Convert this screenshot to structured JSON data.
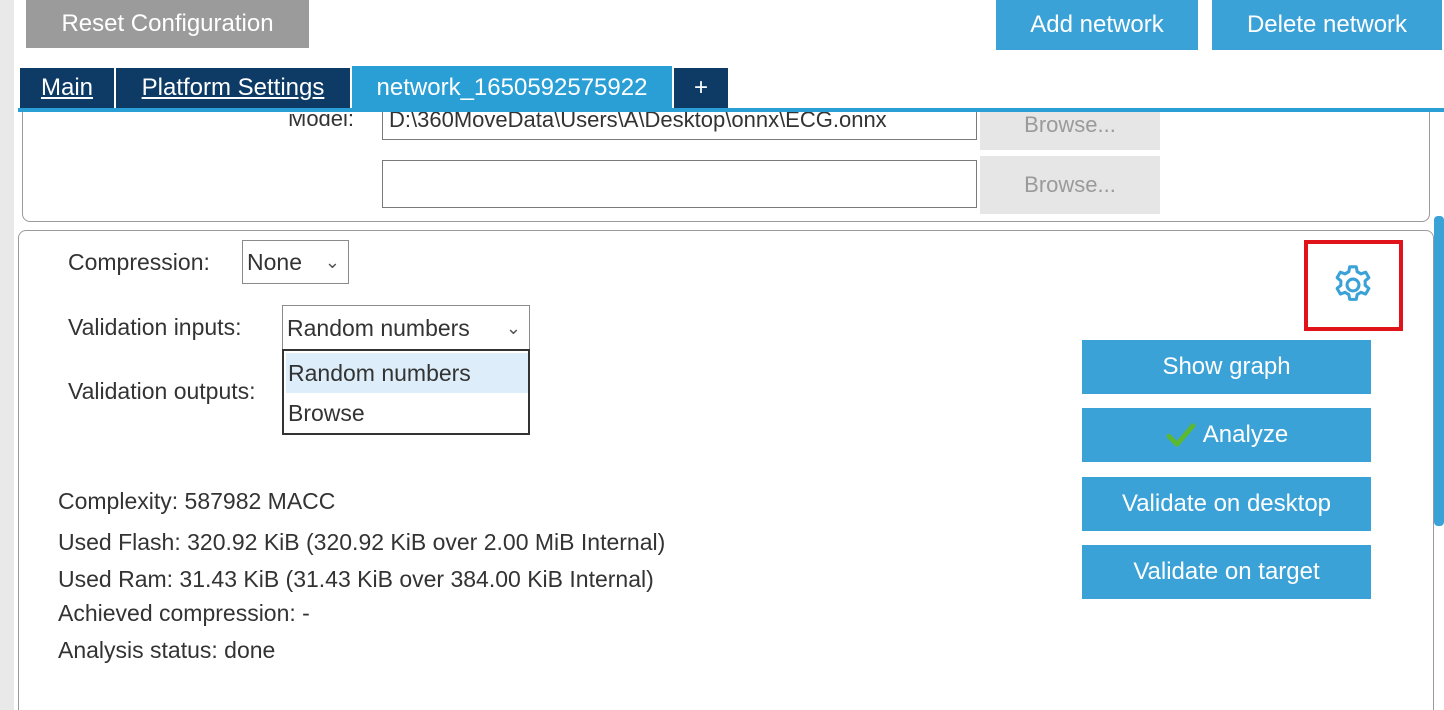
{
  "toolbar": {
    "reset_label": "Reset Configuration",
    "add_network_label": "Add network",
    "delete_network_label": "Delete network"
  },
  "tabs": [
    {
      "label": "Main"
    },
    {
      "label": "Platform Settings"
    },
    {
      "label": "network_1650592575922"
    },
    {
      "label": "+"
    }
  ],
  "model": {
    "label": "Model:",
    "path_value": "D:\\360MoveData\\Users\\A\\Desktop\\onnx\\ECG.onnx",
    "second_value": "",
    "browse_label": "Browse...",
    "browse_label_2": "Browse..."
  },
  "settings": {
    "compression_label": "Compression:",
    "compression_value": "None",
    "validation_inputs_label": "Validation inputs:",
    "validation_inputs_value": "Random numbers",
    "validation_outputs_label": "Validation outputs:",
    "dropdown_options": [
      "Random numbers",
      "Browse"
    ]
  },
  "actions": {
    "show_graph": "Show graph",
    "analyze": "Analyze",
    "validate_desktop": "Validate on desktop",
    "validate_target": "Validate on target"
  },
  "info": {
    "complexity": "Complexity:  587982 MACC",
    "used_flash": "Used Flash: 320.92 KiB (320.92 KiB over 2.00 MiB Internal)",
    "used_ram": "Used Ram: 31.43 KiB (31.43 KiB over 384.00 KiB Internal)",
    "achieved_compression": "Achieved compression: -",
    "analysis_status": "Analysis status: done"
  },
  "icons": {
    "settings": "gear-icon",
    "analyze_status": "check-icon"
  },
  "colors": {
    "accent_blue": "#3ba2d8",
    "tab_dark": "#0d3b66",
    "highlight_red": "#e0121a",
    "check_green": "#5cb82e"
  }
}
